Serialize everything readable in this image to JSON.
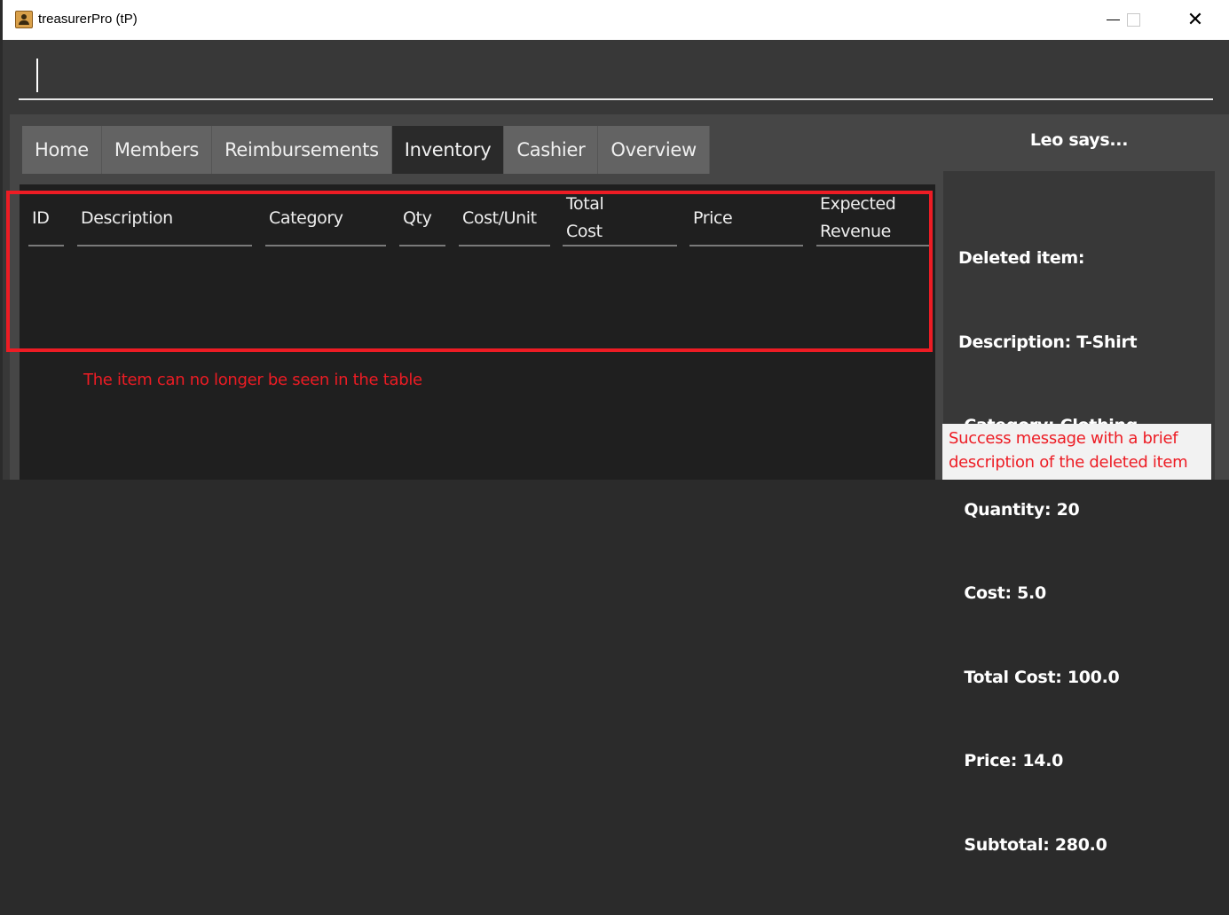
{
  "window": {
    "title": "treasurerPro (tP)",
    "icon": "address-book-icon",
    "controls": {
      "minimize": "minimize-icon",
      "maximize": "maximize-icon",
      "close": "✕"
    }
  },
  "command_box": {
    "value": "",
    "placeholder": ""
  },
  "tabs": [
    {
      "label": "Home",
      "active": false
    },
    {
      "label": "Members",
      "active": false
    },
    {
      "label": "Reimbursements",
      "active": false
    },
    {
      "label": "Inventory",
      "active": true
    },
    {
      "label": "Cashier",
      "active": false
    },
    {
      "label": "Overview",
      "active": false
    }
  ],
  "inventory_table": {
    "columns": [
      "ID",
      "Description",
      "Category",
      "Qty",
      "Cost/Unit",
      "Total Cost",
      "Price",
      "Expected Revenue"
    ],
    "rows": []
  },
  "result_panel": {
    "title": "Leo says...",
    "message_lines": [
      "Deleted item:",
      "Description: T-Shirt",
      " Category: Clothing",
      " Quantity: 20",
      " Cost: 5.0",
      " Total Cost: 100.0",
      " Price: 14.0",
      " Subtotal: 280.0"
    ]
  },
  "annotations": {
    "table_note": "The item can no longer be seen in the table",
    "result_note": "Success message with a brief description of the deleted item",
    "highlight_color": "#ed1c24"
  }
}
